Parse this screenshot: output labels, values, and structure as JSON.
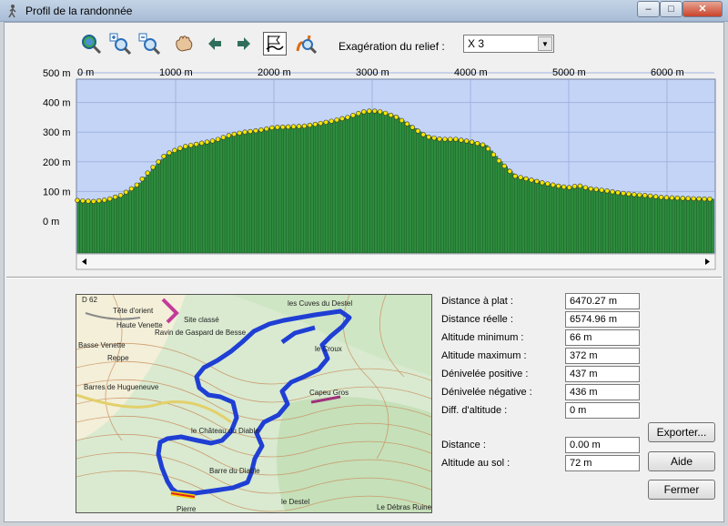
{
  "window": {
    "title": "Profil de la randonnée",
    "minimize": "–",
    "maximize": "□",
    "close": "✕"
  },
  "toolbar": {
    "icons": [
      "zoom-full-icon",
      "zoom-in-icon",
      "zoom-out-icon",
      "pan-hand-icon",
      "arrow-left-icon",
      "arrow-right-icon",
      "profile-flag-icon",
      "route-zoom-icon"
    ],
    "relief_label": "Exagération du relief :",
    "relief_value": "X 3"
  },
  "profile": {
    "x_ticks": [
      "0 m",
      "1000 m",
      "2000 m",
      "3000 m",
      "4000 m",
      "5000 m",
      "6000 m"
    ],
    "y_ticks": [
      "500 m",
      "400 m",
      "300 m",
      "200 m",
      "100 m",
      "0 m"
    ],
    "colors": {
      "sky": "#c4d4f6",
      "terrain": "#2e8c3e",
      "points": "#f2e600",
      "grid": "#9fb3e0"
    }
  },
  "chart_data": {
    "type": "area",
    "title": "",
    "xlabel": "",
    "ylabel": "",
    "xlim": [
      0,
      6470
    ],
    "ylim": [
      0,
      500
    ],
    "x": [
      0,
      150,
      300,
      450,
      600,
      750,
      900,
      1000,
      1100,
      1250,
      1400,
      1550,
      1700,
      1850,
      2000,
      2150,
      2300,
      2450,
      2600,
      2750,
      2900,
      3000,
      3100,
      3250,
      3400,
      3550,
      3700,
      3850,
      4000,
      4150,
      4300,
      4450,
      4600,
      4750,
      4900,
      5000,
      5100,
      5200,
      5350,
      5500,
      5650,
      5800,
      5950,
      6100,
      6250,
      6470
    ],
    "series": [
      {
        "values": [
          70,
          66,
          72,
          88,
          120,
          175,
          225,
          240,
          252,
          262,
          272,
          290,
          300,
          306,
          316,
          318,
          320,
          328,
          338,
          350,
          368,
          372,
          368,
          350,
          318,
          285,
          276,
          276,
          268,
          255,
          200,
          152,
          140,
          128,
          118,
          113,
          120,
          110,
          104,
          96,
          90,
          86,
          80,
          78,
          76,
          74
        ]
      }
    ]
  },
  "map": {
    "labels": [
      "les Cuves du Destel",
      "D 62",
      "Tête d'orient",
      "Haute Venette",
      "Basse Venette",
      "Barres de Hugueneuve",
      "Site classé",
      "Ravin de Gaspard de Besse",
      "Reppe",
      "le Croux",
      "Capeu Gros",
      "le Château du Diable",
      "Barre du Diable",
      "le Destel",
      "Le Débras Ruines",
      "Pierre"
    ]
  },
  "stats": [
    {
      "label": "Distance à plat :",
      "value": "6470.27 m"
    },
    {
      "label": "Distance réelle :",
      "value": "6574.96 m"
    },
    {
      "label": "Altitude minimum :",
      "value": "66 m"
    },
    {
      "label": "Altitude maximum :",
      "value": "372 m"
    },
    {
      "label": "Dénivelée positive :",
      "value": "437 m"
    },
    {
      "label": "Dénivelée négative :",
      "value": "436 m"
    },
    {
      "label": "Diff. d'altitude :",
      "value": "0 m"
    }
  ],
  "cursor": [
    {
      "label": "Distance :",
      "value": "0.00 m"
    },
    {
      "label": "Altitude au sol :",
      "value": "72 m"
    }
  ],
  "buttons": {
    "export": "Exporter...",
    "help": "Aide",
    "close": "Fermer"
  }
}
